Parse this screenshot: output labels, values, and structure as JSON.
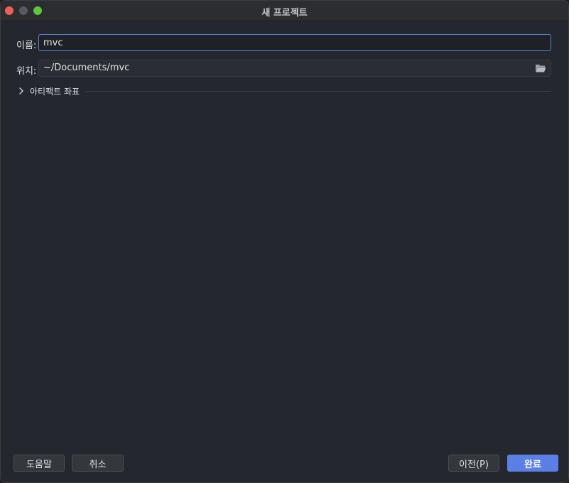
{
  "window": {
    "title": "새 프로젝트"
  },
  "form": {
    "name_label": "이름:",
    "name_value": "mvc",
    "location_label": "위치:",
    "location_value": "~/Documents/mvc",
    "artifact_section_label": "아티팩트 좌표"
  },
  "buttons": {
    "help": "도움말",
    "cancel": "취소",
    "previous": "이전(P)",
    "finish": "완료"
  },
  "icons": {
    "folder": "folder-open-icon",
    "chevron": "chevron-right-icon"
  },
  "colors": {
    "accent": "#5b7fe5",
    "focus_border": "#5f81dd",
    "close": "#ee5f57",
    "maximize": "#5fc53d"
  }
}
